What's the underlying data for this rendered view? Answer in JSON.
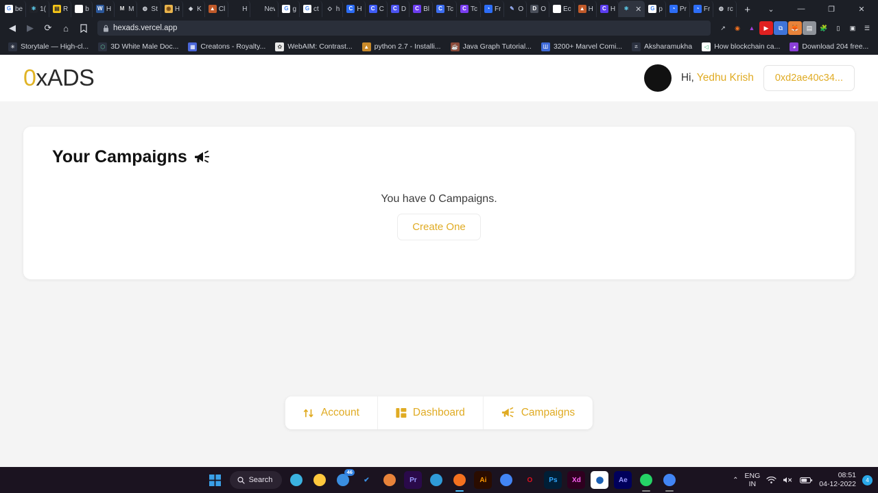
{
  "browser": {
    "name": "Brave",
    "nav": {
      "back": "◀",
      "forward": "▶",
      "reload": "⟳",
      "home": "⌂",
      "bookmark": "🔖"
    },
    "omnibox": {
      "url": "hexads.vercel.app",
      "lock_icon": "lock-icon"
    },
    "window_controls": {
      "tab_search": "⌄",
      "minimize": "—",
      "maximize": "❐",
      "close": "✕"
    },
    "new_tab_label": "+",
    "tabs": [
      {
        "label": "be",
        "glyph": "G",
        "color": "#ffffff",
        "fg": "#4285f4",
        "active": false
      },
      {
        "label": "1(",
        "glyph": "⚛",
        "color": "#20232a",
        "fg": "#61dafb",
        "active": false
      },
      {
        "label": "R",
        "glyph": "▤",
        "color": "#f5c518",
        "fg": "#2b2b2b",
        "active": false
      },
      {
        "label": "b",
        "glyph": "",
        "color": "#ffffff",
        "fg": "#181717",
        "active": false
      },
      {
        "label": "H",
        "glyph": "W",
        "color": "#2b579a",
        "fg": "#ffffff",
        "active": false
      },
      {
        "label": "M",
        "glyph": "M",
        "color": "#1c1f26",
        "fg": "#e8e8e8",
        "active": false
      },
      {
        "label": "St",
        "glyph": "◍",
        "color": "#1c1f26",
        "fg": "#d8dbe2",
        "active": false
      },
      {
        "label": "H",
        "glyph": "◉",
        "color": "#e9b44c",
        "fg": "#7a4b14",
        "active": false
      },
      {
        "label": "K",
        "glyph": "◈",
        "color": "#1c1f26",
        "fg": "#d8dbe2",
        "active": false
      },
      {
        "label": "Cl",
        "glyph": "▲",
        "color": "#c05a2a",
        "fg": "#ffffff",
        "active": false
      },
      {
        "label": "H",
        "glyph": "",
        "color": "#1c1f26",
        "fg": "#d8dbe2",
        "active": false
      },
      {
        "label": "New",
        "glyph": "",
        "color": "#1c1f26",
        "fg": "#d8dbe2",
        "active": false
      },
      {
        "label": "g",
        "glyph": "G",
        "color": "#ffffff",
        "fg": "#4285f4",
        "active": false
      },
      {
        "label": "ct",
        "glyph": "G",
        "color": "#ffffff",
        "fg": "#4285f4",
        "active": false
      },
      {
        "label": "h",
        "glyph": "◇",
        "color": "#1c1f26",
        "fg": "#d8dbe2",
        "active": false
      },
      {
        "label": "H",
        "glyph": "C",
        "color": "#2d6df6",
        "fg": "#ffffff",
        "active": false
      },
      {
        "label": "C",
        "glyph": "C",
        "color": "#3f5cf6",
        "fg": "#ffffff",
        "active": false
      },
      {
        "label": "D",
        "glyph": "C",
        "color": "#4b53f0",
        "fg": "#ffffff",
        "active": false
      },
      {
        "label": "Bl",
        "glyph": "C",
        "color": "#6c3df0",
        "fg": "#ffffff",
        "active": false
      },
      {
        "label": "Tc",
        "glyph": "C",
        "color": "#3d6df0",
        "fg": "#ffffff",
        "active": false
      },
      {
        "label": "Tc",
        "glyph": "C",
        "color": "#7a3df0",
        "fg": "#ffffff",
        "active": false
      },
      {
        "label": "Fr",
        "glyph": "◔",
        "color": "#2d6df6",
        "fg": "#ffffff",
        "active": false
      },
      {
        "label": "O",
        "glyph": "✎",
        "color": "#1c1f26",
        "fg": "#9fb6ff",
        "active": false
      },
      {
        "label": "O",
        "glyph": "D",
        "color": "#4a4f5a",
        "fg": "#ffffff",
        "active": false
      },
      {
        "label": "Ec",
        "glyph": "",
        "color": "#ffffff",
        "fg": "#181717",
        "active": false
      },
      {
        "label": "H",
        "glyph": "▲",
        "color": "#c05a2a",
        "fg": "#ffffff",
        "active": false
      },
      {
        "label": "H",
        "glyph": "C",
        "color": "#5b3df0",
        "fg": "#ffffff",
        "active": false
      },
      {
        "label": "",
        "glyph": "⚛",
        "color": "#2f343f",
        "fg": "#61dafb",
        "active": true
      },
      {
        "label": "p",
        "glyph": "G",
        "color": "#ffffff",
        "fg": "#4285f4",
        "active": false
      },
      {
        "label": "Pr",
        "glyph": "◔",
        "color": "#2d6df6",
        "fg": "#ffffff",
        "active": false
      },
      {
        "label": "Fr",
        "glyph": "◔",
        "color": "#2d6df6",
        "fg": "#ffffff",
        "active": false
      },
      {
        "label": "rc",
        "glyph": "◍",
        "color": "#1c1f26",
        "fg": "#d8dbe2",
        "active": false
      }
    ],
    "extensions": [
      {
        "name": "share-icon",
        "glyph": "↗",
        "color": "transparent",
        "fg": "#d8dbe2"
      },
      {
        "name": "brave-shields-icon",
        "glyph": "◉",
        "color": "transparent",
        "fg": "#f4711f"
      },
      {
        "name": "brave-rewards-icon",
        "glyph": "▲",
        "color": "transparent",
        "fg": "#a13fd8"
      },
      {
        "name": "youtube-extension-icon",
        "glyph": "▶",
        "color": "#e02020",
        "fg": "#ffffff"
      },
      {
        "name": "translate-extension-icon",
        "glyph": "⧉",
        "color": "#3f74d8",
        "fg": "#ffffff"
      },
      {
        "name": "metamask-extension-icon",
        "glyph": "🦊",
        "color": "#e8833a",
        "fg": "#ffffff"
      },
      {
        "name": "screenshot-extension-icon",
        "glyph": "▤",
        "color": "#8e9299",
        "fg": "#ffffff"
      },
      {
        "name": "puzzle-extensions-icon",
        "glyph": "🧩",
        "color": "transparent",
        "fg": "#e6e8ec"
      },
      {
        "name": "sidebar-icon",
        "glyph": "▯",
        "color": "transparent",
        "fg": "#e6e8ec"
      },
      {
        "name": "wallet-icon",
        "glyph": "▣",
        "color": "transparent",
        "fg": "#e6e8ec"
      },
      {
        "name": "menu-icon",
        "glyph": "☰",
        "color": "transparent",
        "fg": "#e6e8ec"
      }
    ],
    "bookmarks": [
      {
        "label": "Storytale — High-cl...",
        "glyph": "✳",
        "color": "#2b3140",
        "fg": "#ffffff"
      },
      {
        "label": "3D White Male Doc...",
        "glyph": "⬡",
        "color": "#2b3140",
        "fg": "#67d0a0"
      },
      {
        "label": "Creatons - Royalty...",
        "glyph": "▦",
        "color": "#4a66d8",
        "fg": "#ffffff"
      },
      {
        "label": "WebAIM: Contrast...",
        "glyph": "✿",
        "color": "#e9e9e9",
        "fg": "#444444"
      },
      {
        "label": "python 2.7 - Installi...",
        "glyph": "▲",
        "color": "#c98a2a",
        "fg": "#ffffff"
      },
      {
        "label": "Java Graph Tutorial...",
        "glyph": "☕",
        "color": "#8a4a3a",
        "fg": "#ffffff"
      },
      {
        "label": "3200+ Marvel Comi...",
        "glyph": "Ш",
        "color": "#3f6ad8",
        "fg": "#ffffff"
      },
      {
        "label": "Aksharamukha",
        "glyph": "౽",
        "color": "#2b3140",
        "fg": "#d2d5dc"
      },
      {
        "label": "How blockchain ca...",
        "glyph": "◁",
        "color": "#ffffff",
        "fg": "#2aa86a"
      },
      {
        "label": "Download 204 free...",
        "glyph": "◕",
        "color": "#8a3fd8",
        "fg": "#ffffff"
      }
    ],
    "bookmarks_overflow": "»"
  },
  "site": {
    "logo": {
      "prefix": "0",
      "suffix": "xADS",
      "prefix_color": "#e0b325",
      "suffix_color": "#2b2b2b"
    },
    "user": {
      "greeting_prefix": "Hi,",
      "name": "Yedhu Krish",
      "wallet": "0xd2ae40c34...",
      "avatar": "avatar-circle"
    },
    "card": {
      "title": "Your Campaigns",
      "title_icon": "megaphone-icon",
      "empty_text": "You have 0 Campaigns.",
      "create_button": "Create One"
    },
    "bottom_nav": [
      {
        "label": "Account",
        "icon": "exchange-arrows-icon"
      },
      {
        "label": "Dashboard",
        "icon": "dashboard-grid-icon"
      },
      {
        "label": "Campaigns",
        "icon": "megaphone-icon"
      }
    ],
    "colors": {
      "accent": "#e0ab23",
      "page_bg": "#f4f4f4",
      "card_bg": "#ffffff"
    }
  },
  "taskbar": {
    "start": "start-button",
    "search_label": "Search",
    "apps": [
      {
        "name": "microsoft-edge-icon",
        "glyph": "",
        "color": "transparent",
        "fg": "#3bb2e0",
        "badge": "",
        "running": false
      },
      {
        "name": "file-explorer-icon",
        "glyph": "",
        "color": "transparent",
        "fg": "#ffc83d",
        "badge": "",
        "running": false
      },
      {
        "name": "mail-icon",
        "glyph": "",
        "color": "transparent",
        "fg": "#3a8ee0",
        "badge": "46",
        "running": false
      },
      {
        "name": "todo-icon",
        "glyph": "✔",
        "color": "transparent",
        "fg": "#3a8ee0",
        "badge": "",
        "running": false
      },
      {
        "name": "firefox-icon",
        "glyph": "",
        "color": "transparent",
        "fg": "#e8833a",
        "badge": "",
        "running": false
      },
      {
        "name": "premiere-pro-icon",
        "glyph": "Pr",
        "color": "#2a0a4a",
        "fg": "#9a9aff",
        "badge": "",
        "running": false
      },
      {
        "name": "vscode-icon",
        "glyph": "",
        "color": "transparent",
        "fg": "#2f9bd8",
        "badge": "",
        "running": false
      },
      {
        "name": "brave-browser-icon",
        "glyph": "",
        "color": "transparent",
        "fg": "#f4711f",
        "badge": "",
        "running": true
      },
      {
        "name": "illustrator-icon",
        "glyph": "Ai",
        "color": "#2a0c00",
        "fg": "#ff9a00",
        "badge": "",
        "running": false
      },
      {
        "name": "google-chrome-icon",
        "glyph": "",
        "color": "transparent",
        "fg": "#4285f4",
        "badge": "",
        "running": false
      },
      {
        "name": "opera-icon",
        "glyph": "O",
        "color": "transparent",
        "fg": "#e01020",
        "badge": "",
        "running": false
      },
      {
        "name": "photoshop-icon",
        "glyph": "Ps",
        "color": "#001e36",
        "fg": "#31a8ff",
        "badge": "",
        "running": false
      },
      {
        "name": "adobe-xd-icon",
        "glyph": "Xd",
        "color": "#2e001f",
        "fg": "#ff61f6",
        "badge": "",
        "running": false
      },
      {
        "name": "figma-icon",
        "glyph": "⬤",
        "color": "#ffffff",
        "fg": "#1a5fb4",
        "badge": "",
        "running": false
      },
      {
        "name": "after-effects-icon",
        "glyph": "Ae",
        "color": "#00005b",
        "fg": "#9999ff",
        "badge": "",
        "running": false
      },
      {
        "name": "whatsapp-icon",
        "glyph": "",
        "color": "transparent",
        "fg": "#25d366",
        "badge": "",
        "running": true
      },
      {
        "name": "chrome-beta-icon",
        "glyph": "",
        "color": "transparent",
        "fg": "#4285f4",
        "badge": "",
        "running": true
      }
    ],
    "tray": {
      "chevron": "⌃",
      "language": "ENG",
      "region": "IN",
      "wifi_icon": "wifi-icon",
      "volume_icon": "volume-muted-icon",
      "battery_icon": "battery-icon",
      "time": "08:51",
      "date": "04-12-2022",
      "notification_count": "4"
    }
  }
}
